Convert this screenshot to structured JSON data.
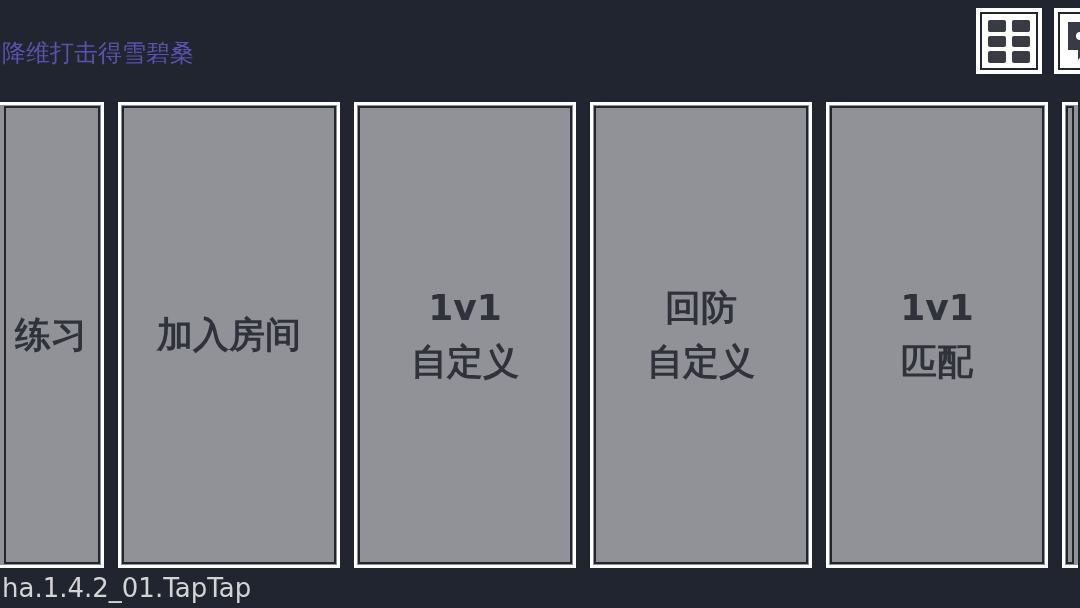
{
  "header": {
    "title": "降维打击得雪碧桑"
  },
  "cards": [
    {
      "kind": "cut-left",
      "lines": [
        "练习"
      ]
    },
    {
      "kind": "full",
      "lines": [
        "加入房间"
      ]
    },
    {
      "kind": "full",
      "lines": [
        "1v1",
        "自定义"
      ]
    },
    {
      "kind": "full",
      "lines": [
        "回防",
        "自定义"
      ]
    },
    {
      "kind": "full",
      "lines": [
        "1v1",
        "匹配"
      ]
    },
    {
      "kind": "cut-right"
    }
  ],
  "footer": {
    "version": "ha.1.4.2_01.TapTap"
  }
}
